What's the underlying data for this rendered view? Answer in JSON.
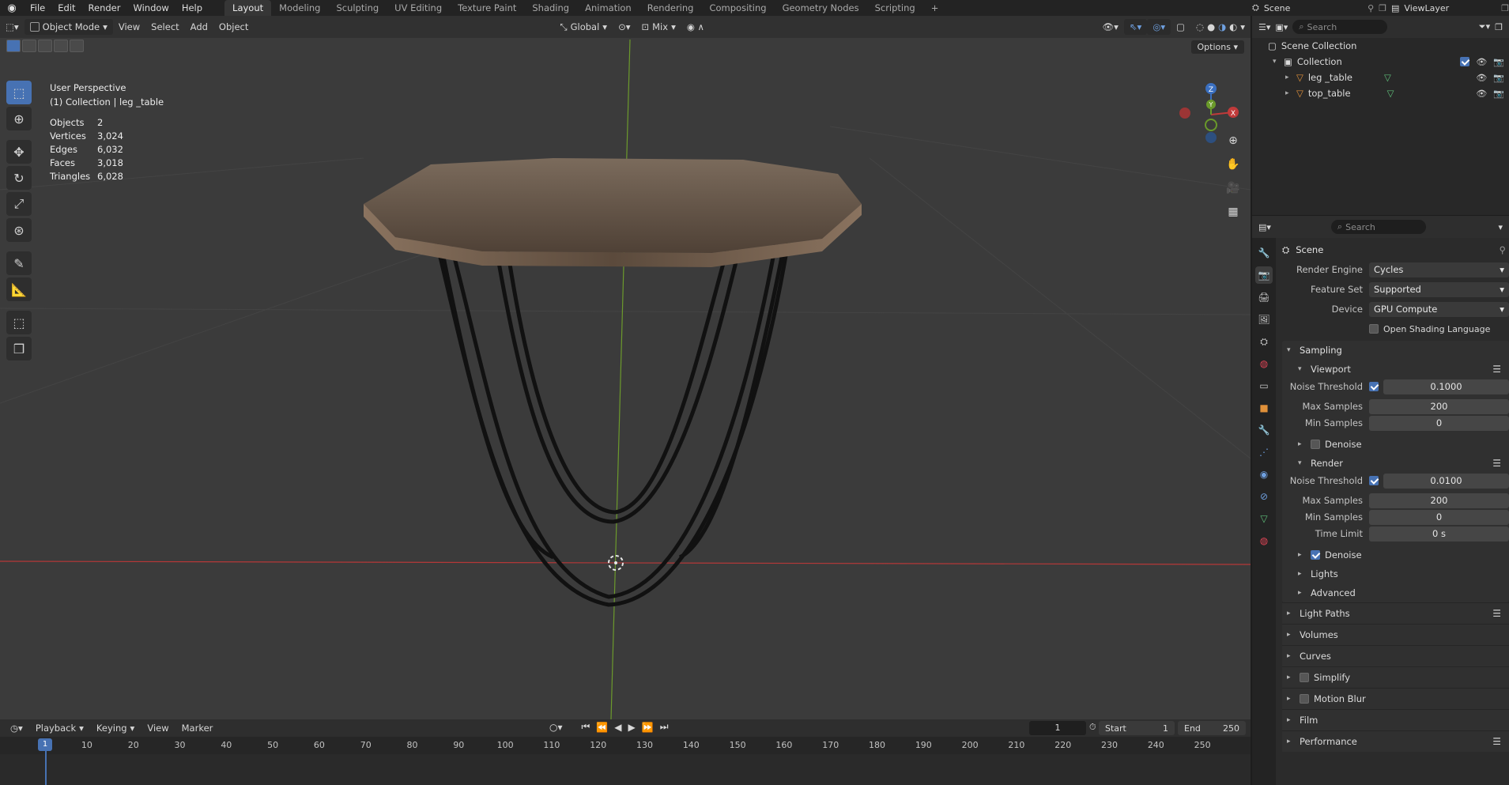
{
  "topbar": {
    "menus": [
      "File",
      "Edit",
      "Render",
      "Window",
      "Help"
    ],
    "workspaces": [
      "Layout",
      "Modeling",
      "Sculpting",
      "UV Editing",
      "Texture Paint",
      "Shading",
      "Animation",
      "Rendering",
      "Compositing",
      "Geometry Nodes",
      "Scripting"
    ],
    "active_workspace": "Layout",
    "add_tab": "+",
    "scene_name": "Scene",
    "view_layer": "ViewLayer"
  },
  "viewport": {
    "mode": "Object Mode",
    "menus": [
      "View",
      "Select",
      "Add",
      "Object"
    ],
    "transform_orientation": "Global",
    "snap_mode": "Mix",
    "options_label": "Options",
    "perspective": "User Perspective",
    "collection_info": "(1) Collection | leg _table",
    "stats": [
      {
        "label": "Objects",
        "value": "2"
      },
      {
        "label": "Vertices",
        "value": "3,024"
      },
      {
        "label": "Edges",
        "value": "6,032"
      },
      {
        "label": "Faces",
        "value": "3,018"
      },
      {
        "label": "Triangles",
        "value": "6,028"
      }
    ],
    "gizmo_axes": [
      "Z",
      "Y",
      "X"
    ]
  },
  "outliner": {
    "search_placeholder": "Search",
    "root": "Scene Collection",
    "collection": "Collection",
    "objects": [
      "leg _table",
      "top_table"
    ]
  },
  "properties": {
    "search_placeholder": "Search",
    "context": "Scene",
    "render_engine_label": "Render Engine",
    "render_engine": "Cycles",
    "feature_set_label": "Feature Set",
    "feature_set": "Supported",
    "device_label": "Device",
    "device": "GPU Compute",
    "osl_label": "Open Shading Language",
    "sampling": {
      "title": "Sampling",
      "viewport": {
        "title": "Viewport",
        "noise_threshold_label": "Noise Threshold",
        "noise_threshold": "0.1000",
        "max_samples_label": "Max Samples",
        "max_samples": "200",
        "min_samples_label": "Min Samples",
        "min_samples": "0",
        "denoise_label": "Denoise"
      },
      "render": {
        "title": "Render",
        "noise_threshold_label": "Noise Threshold",
        "noise_threshold": "0.0100",
        "max_samples_label": "Max Samples",
        "max_samples": "200",
        "min_samples_label": "Min Samples",
        "min_samples": "0",
        "time_limit_label": "Time Limit",
        "time_limit": "0 s",
        "denoise_label": "Denoise"
      },
      "lights": "Lights",
      "advanced": "Advanced"
    },
    "panels": [
      "Light Paths",
      "Volumes",
      "Curves",
      "Simplify",
      "Motion Blur",
      "Film",
      "Performance"
    ]
  },
  "timeline": {
    "menus": [
      "Playback",
      "Keying",
      "View",
      "Marker"
    ],
    "current_frame": "1",
    "start_label": "Start",
    "start": "1",
    "end_label": "End",
    "end": "250",
    "ticks": [
      "10",
      "20",
      "30",
      "40",
      "50",
      "60",
      "70",
      "80",
      "90",
      "100",
      "110",
      "120",
      "130",
      "140",
      "150",
      "160",
      "170",
      "180",
      "190",
      "200",
      "210",
      "220",
      "230",
      "240",
      "250"
    ],
    "playhead": "1"
  },
  "colors": {
    "accent": "#4772b3",
    "x_axis": "#c03a3a",
    "y_axis": "#6a9a2a",
    "z_axis": "#3a6fc0"
  }
}
